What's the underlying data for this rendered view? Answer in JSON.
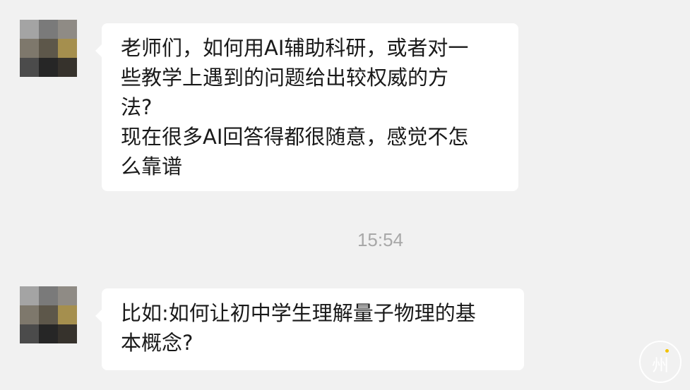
{
  "chat": {
    "messages": [
      {
        "lines": [
          "老师们，如何用AI辅助科研，或者对一",
          "些教学上遇到的问题给出较权威的方",
          "法?",
          "现在很多AI回答得都很随意，感觉不怎",
          "么靠谱"
        ]
      },
      {
        "lines": [
          "比如:如何让初中学生理解量子物理的基",
          "本概念?"
        ]
      }
    ],
    "timestamp": "15:54"
  },
  "colors": {
    "background": "#f1f1f1",
    "bubble": "#ffffff",
    "text": "#191919",
    "timestamp": "#a8a8a8"
  },
  "watermark": {
    "glyph": "州"
  }
}
